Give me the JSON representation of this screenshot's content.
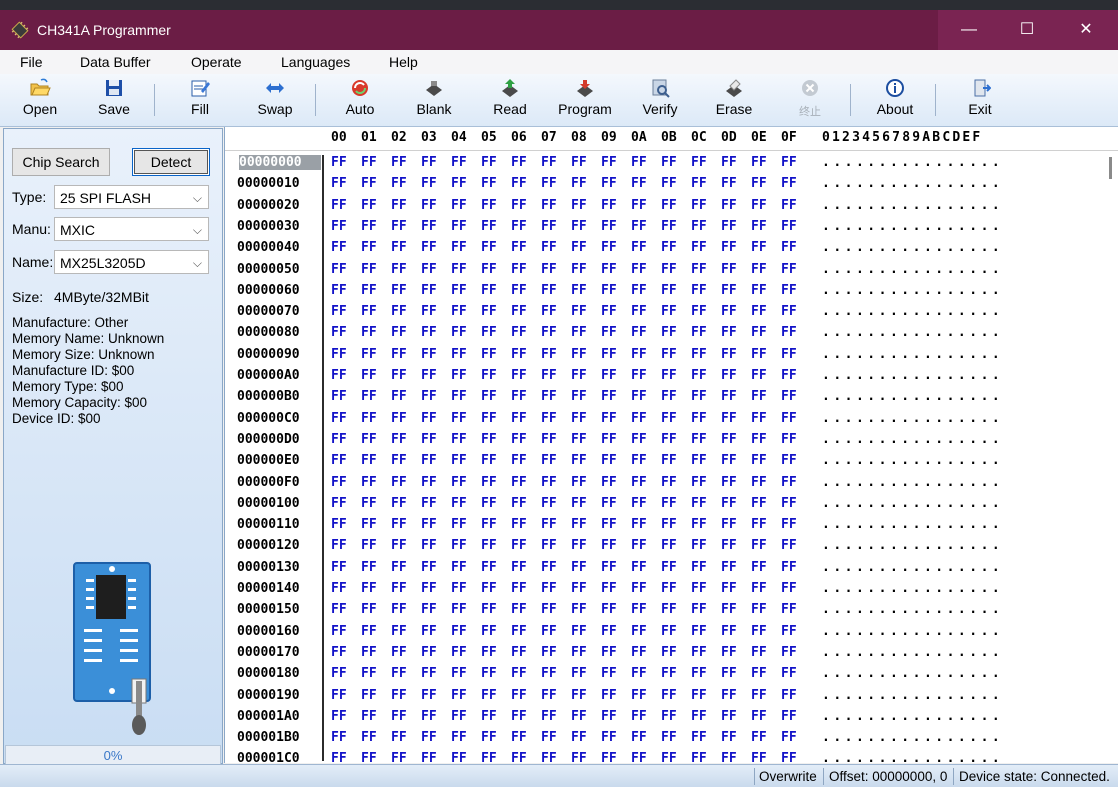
{
  "window": {
    "title": "CH341A Programmer",
    "minimize": "—",
    "maximize": "☐",
    "close": "✕"
  },
  "menu": [
    "File",
    "Data Buffer",
    "Operate",
    "Languages",
    "Help"
  ],
  "toolbar": {
    "open": "Open",
    "save": "Save",
    "fill": "Fill",
    "swap": "Swap",
    "auto": "Auto",
    "blank": "Blank",
    "read": "Read",
    "program": "Program",
    "verify": "Verify",
    "erase": "Erase",
    "stop": "终止",
    "about": "About",
    "exit": "Exit"
  },
  "chip": {
    "search_button": "Chip Search",
    "detect_button": "Detect",
    "type_label": "Type:",
    "type_value": "25 SPI FLASH",
    "manu_label": "Manu:",
    "manu_value": "MXIC",
    "name_label": "Name:",
    "name_value": "MX25L3205D",
    "size_label": "Size:",
    "size_value": "4MByte/32MBit",
    "info": [
      "Manufacture: Other",
      "Memory Name: Unknown",
      "Memory Size: Unknown",
      "Manufacture ID: $00",
      "Memory Type: $00",
      "Memory Capacity: $00",
      "Device ID: $00"
    ],
    "progress": "0%"
  },
  "hex": {
    "columns": [
      "00",
      "01",
      "02",
      "03",
      "04",
      "05",
      "06",
      "07",
      "08",
      "09",
      "0A",
      "0B",
      "0C",
      "0D",
      "0E",
      "0F"
    ],
    "ascii_header": "0123456789ABCDEF",
    "fill_byte": "FF",
    "ascii_row": "................",
    "selected_row": 0,
    "addresses": [
      "00000000",
      "00000010",
      "00000020",
      "00000030",
      "00000040",
      "00000050",
      "00000060",
      "00000070",
      "00000080",
      "00000090",
      "000000A0",
      "000000B0",
      "000000C0",
      "000000D0",
      "000000E0",
      "000000F0",
      "00000100",
      "00000110",
      "00000120",
      "00000130",
      "00000140",
      "00000150",
      "00000160",
      "00000170",
      "00000180",
      "00000190",
      "000001A0",
      "000001B0",
      "000001C0"
    ]
  },
  "status": {
    "mode": "Overwrite",
    "offset": "Offset: 00000000, 0",
    "device_state": "Device state: Connected."
  },
  "colors": {
    "titlebar": "#6b1d45",
    "hex_values": "#1212c8"
  }
}
